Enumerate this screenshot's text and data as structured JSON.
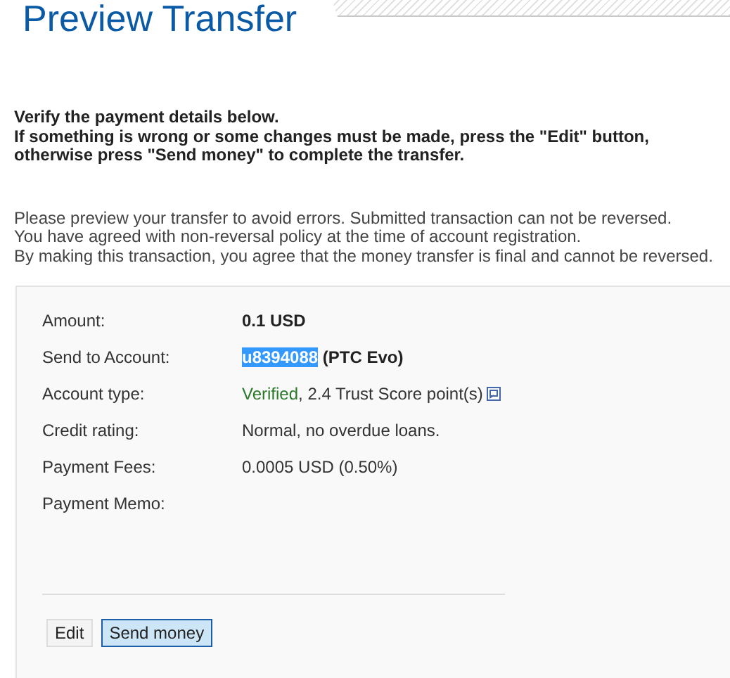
{
  "title": "Preview Transfer",
  "instructions": [
    "Verify the payment details below.",
    "If something is wrong or some changes must be made, press the \"Edit\" button, otherwise press \"Send money\" to complete the transfer."
  ],
  "notice": [
    "Please preview your transfer to avoid errors. Submitted transaction can not be reversed.",
    "You have agreed with non-reversal policy at the time of account registration.",
    "By making this transaction, you agree that the money transfer is final and cannot be reversed."
  ],
  "details": [
    {
      "label": "Amount:",
      "parts": [
        {
          "text": "0.1 USD",
          "kind": "bold"
        }
      ]
    },
    {
      "label": "Send to Account:",
      "parts": [
        {
          "text": "u8394088",
          "kind": "selected"
        },
        {
          "text": " (PTC Evo)",
          "kind": "bold"
        }
      ]
    },
    {
      "label": "Account type:",
      "parts": [
        {
          "text": "Verified",
          "kind": "green"
        },
        {
          "text": ", 2.4 Trust Score point(s)",
          "kind": "plain"
        }
      ],
      "info_icon": true
    },
    {
      "label": "Credit rating:",
      "parts": [
        {
          "text": "Normal, no overdue loans.",
          "kind": "plain"
        }
      ]
    },
    {
      "label": "Payment Fees:",
      "parts": [
        {
          "text": "0.0005 USD (0.50%)",
          "kind": "plain"
        }
      ]
    },
    {
      "label": "Payment Memo:"
    }
  ],
  "buttons": [
    {
      "label": "Edit",
      "focused": false
    },
    {
      "label": "Send money",
      "focused": true
    }
  ]
}
